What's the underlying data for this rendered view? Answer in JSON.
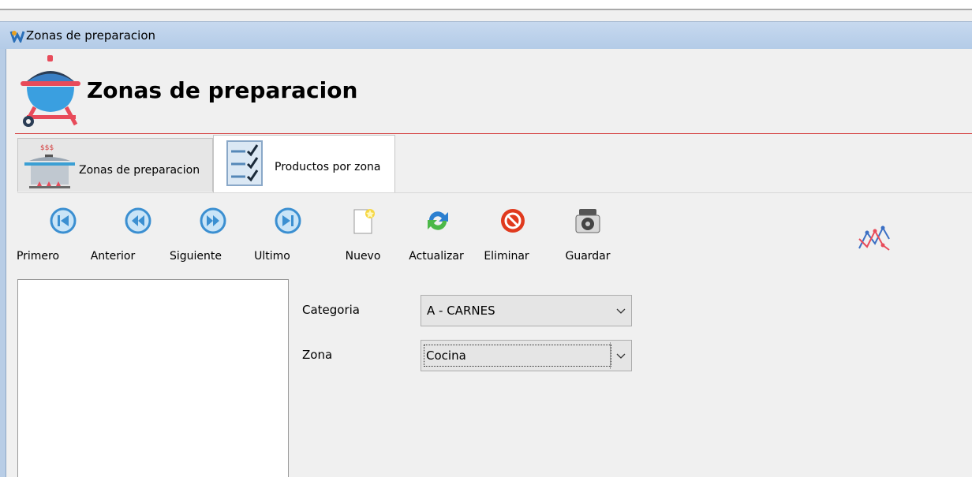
{
  "window": {
    "title": "Zonas de preparacion"
  },
  "header": {
    "title": "Zonas de preparacion"
  },
  "tabs": [
    {
      "label": "Zonas de preparacion",
      "icon": "cooking-pot-icon",
      "active": false
    },
    {
      "label": "Productos por zona",
      "icon": "checklist-icon",
      "active": true
    }
  ],
  "toolbar": {
    "primero": "Primero",
    "anterior": "Anterior",
    "siguiente": "Siguiente",
    "ultimo": "Ultimo",
    "nuevo": "Nuevo",
    "actualizar": "Actualizar",
    "eliminar": "Eliminar",
    "guardar": "Guardar"
  },
  "form": {
    "categoria_label": "Categoria",
    "categoria_value": "A - CARNES",
    "zona_label": "Zona",
    "zona_value": "Cocina"
  },
  "colors": {
    "accent_red": "#d43b3b",
    "nav_blue": "#3b8fd1",
    "titlebar": "#b3cbe7"
  }
}
